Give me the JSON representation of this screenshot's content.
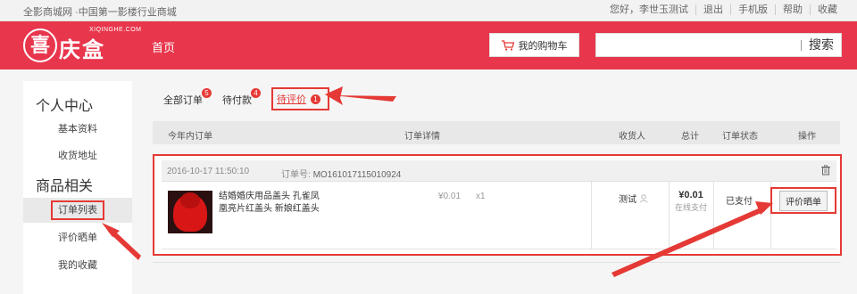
{
  "topbar": {
    "slogan": "全影商城网 ·中国第一影楼行业商城",
    "links": [
      "您好，李世玉测试",
      "退出",
      "手机版",
      "帮助",
      "收藏"
    ]
  },
  "header": {
    "logo_mark": "喜",
    "logo_text": "庆盒",
    "logo_domain": "XIQINGHE.COM",
    "nav_home": "首页",
    "cart_label": "我的购物车",
    "search_value": "",
    "search_button": "搜索"
  },
  "sidebar": {
    "group_personal": "个人中心",
    "personal_items": [
      "基本资料",
      "收货地址"
    ],
    "group_goods": "商品相关",
    "goods_items": [
      "订单列表",
      "评价晒单",
      "我的收藏"
    ]
  },
  "tabs": [
    {
      "label": "全部订单",
      "badge": "5"
    },
    {
      "label": "待付款",
      "badge": "4"
    },
    {
      "label": "待评价",
      "badge": "1"
    }
  ],
  "table_header": {
    "recent": "今年内订单",
    "detail": "订单详情",
    "receiver": "收货人",
    "total": "总计",
    "status": "订单状态",
    "action": "操作"
  },
  "order": {
    "date": "2016-10-17 11:50:10",
    "no_label": "订单号:",
    "no_value": "MO161017115010924",
    "product_name": "结婚婚庆用品盖头 孔雀凤凰亮片红盖头 新娘红盖头",
    "price": "¥0.01",
    "qty": "x1",
    "receiver": "测试",
    "total": "¥0.01",
    "pay_method": "在线支付",
    "status": "已支付",
    "review_button": "评价晒单"
  },
  "colors": {
    "brand_red": "#e8364c",
    "annotation_red": "#e53935"
  },
  "icons": {
    "cart": "cart-icon",
    "trash": "trash-icon",
    "user": "user-icon"
  }
}
